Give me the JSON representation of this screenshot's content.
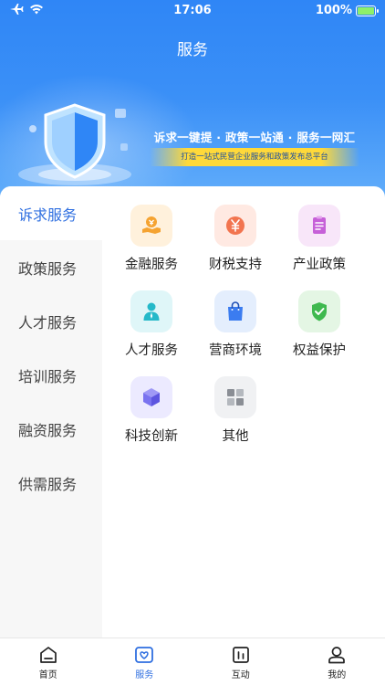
{
  "status_bar": {
    "time": "17:06",
    "battery": "100%"
  },
  "header": {
    "title": "服务",
    "slogan": "诉求一键提 · 政策一站通 · 服务一网汇",
    "subslogan": "打造一站式民营企业服务和政策发布总平台"
  },
  "sidebar": {
    "items": [
      {
        "label": "诉求服务",
        "active": true
      },
      {
        "label": "政策服务",
        "active": false
      },
      {
        "label": "人才服务",
        "active": false
      },
      {
        "label": "培训服务",
        "active": false
      },
      {
        "label": "融资服务",
        "active": false
      },
      {
        "label": "供需服务",
        "active": false
      }
    ]
  },
  "services": [
    {
      "label": "金融服务",
      "icon": "finance-icon",
      "bg": "#fff1dc",
      "color": "#f5a331"
    },
    {
      "label": "财税支持",
      "icon": "yuan-icon",
      "bg": "#ffe9e2",
      "color": "#f2744f"
    },
    {
      "label": "产业政策",
      "icon": "clipboard-icon",
      "bg": "#f8e6f9",
      "color": "#c660d8"
    },
    {
      "label": "人才服务",
      "icon": "person-icon",
      "bg": "#dff6f8",
      "color": "#25b9c9"
    },
    {
      "label": "营商环境",
      "icon": "shopping-bag-icon",
      "bg": "#e4eefd",
      "color": "#3b7cf0"
    },
    {
      "label": "权益保护",
      "icon": "shield-check-icon",
      "bg": "#e4f6e4",
      "color": "#3fb94f"
    },
    {
      "label": "科技创新",
      "icon": "cube-icon",
      "bg": "#eceaff",
      "color": "#7a73f0"
    },
    {
      "label": "其他",
      "icon": "grid-icon",
      "bg": "#f0f1f3",
      "color": "#8a8e95"
    }
  ],
  "tabbar": {
    "items": [
      {
        "label": "首页",
        "icon": "home-icon",
        "active": false
      },
      {
        "label": "服务",
        "icon": "heart-icon",
        "active": true
      },
      {
        "label": "互动",
        "icon": "chart-icon",
        "active": false
      },
      {
        "label": "我的",
        "icon": "user-icon",
        "active": false
      }
    ]
  },
  "colors": {
    "primary": "#2f6fe0",
    "hero": "#3b90f7"
  }
}
